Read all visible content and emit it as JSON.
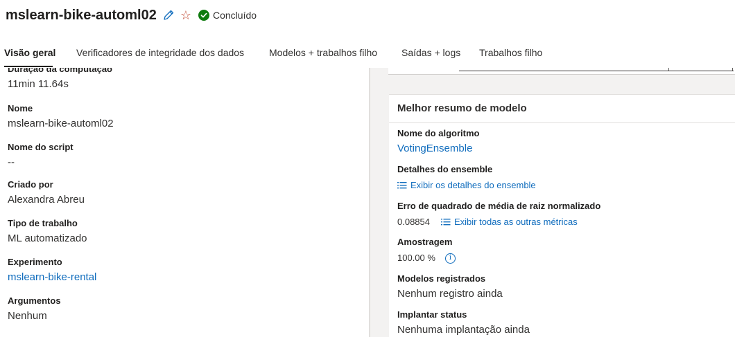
{
  "header": {
    "title": "mslearn-bike-automl02",
    "status_label": "Concluído",
    "icons": {
      "edit": "pencil-icon",
      "favorite": "star-icon",
      "status": "check-circle-icon"
    },
    "colors": {
      "success": "#107c10",
      "link": "#0f6cbd",
      "star": "#c4523c"
    }
  },
  "tabs": [
    {
      "label": "Visão geral",
      "active": true
    },
    {
      "label": "Verificadores de integridade dos dados",
      "active": false
    },
    {
      "label": "Modelos + trabalhos filho",
      "active": false
    },
    {
      "label": "Saídas + logs",
      "active": false
    },
    {
      "label": "Trabalhos filho",
      "active": false
    }
  ],
  "details": {
    "compute_duration": {
      "label": "Duração da computação",
      "value": "11min 11.64s"
    },
    "name": {
      "label": "Nome",
      "value": "mslearn-bike-automl02"
    },
    "script_name": {
      "label": "Nome do script",
      "value": "--"
    },
    "created_by": {
      "label": "Criado por",
      "value": "Alexandra Abreu"
    },
    "job_type": {
      "label": "Tipo de trabalho",
      "value": "ML automatizado"
    },
    "experiment": {
      "label": "Experimento",
      "value": "mslearn-bike-rental"
    },
    "arguments": {
      "label": "Argumentos",
      "value": "Nenhum"
    }
  },
  "best_model": {
    "title": "Melhor resumo de modelo",
    "algorithm": {
      "label": "Nome do algoritmo",
      "value": "VotingEnsemble"
    },
    "ensemble": {
      "label": "Detalhes do ensemble",
      "link": "Exibir os detalhes do ensemble"
    },
    "nrmse": {
      "label": "Erro de quadrado de média de raiz normalizado",
      "value": "0.08854",
      "link": "Exibir todas as outras métricas"
    },
    "sampling": {
      "label": "Amostragem",
      "value": "100.00 %"
    },
    "registered": {
      "label": "Modelos registrados",
      "value": "Nenhum registro ainda"
    },
    "deploy": {
      "label": "Implantar status",
      "value": "Nenhuma implantação ainda"
    }
  }
}
